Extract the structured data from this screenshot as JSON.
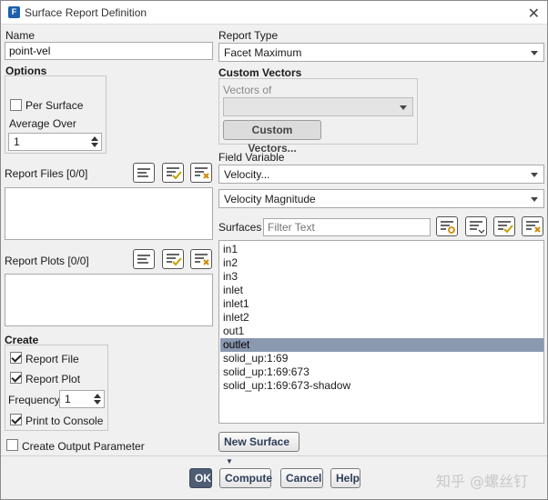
{
  "window": {
    "title": "Surface Report Definition",
    "icon": "fluent-app-icon",
    "close": "✕"
  },
  "name": {
    "label": "Name",
    "value": "point-vel"
  },
  "options": {
    "label": "Options",
    "per_surface_label": "Per Surface",
    "per_surface_checked": false,
    "average_over_label": "Average Over",
    "average_over_value": "1"
  },
  "report_files": {
    "label": "Report Files [0/0]"
  },
  "report_plots": {
    "label": "Report Plots [0/0]"
  },
  "create": {
    "label": "Create",
    "report_file_label": "Report File",
    "report_file_checked": true,
    "report_plot_label": "Report Plot",
    "report_plot_checked": true,
    "frequency_label": "Frequency",
    "frequency_value": "1",
    "print_console_label": "Print to Console",
    "print_console_checked": true
  },
  "create_output_param": {
    "label": "Create Output Parameter",
    "checked": false
  },
  "report_type": {
    "label": "Report Type",
    "value": "Facet Maximum"
  },
  "custom_vectors": {
    "label": "Custom Vectors",
    "vectors_of_label": "Vectors of",
    "vectors_of_value": "",
    "button": "Custom Vectors..."
  },
  "field_variable": {
    "label": "Field Variable",
    "category": "Velocity...",
    "quantity": "Velocity Magnitude"
  },
  "surfaces": {
    "label": "Surfaces",
    "filter_placeholder": "Filter Text",
    "items": [
      "in1",
      "in2",
      "in3",
      "inlet",
      "inlet1",
      "inlet2",
      "out1",
      "outlet",
      "solid_up:1:69",
      "solid_up:1:69:673",
      "solid_up:1:69:673-shadow"
    ],
    "selected": "outlet",
    "new_surface_button": "New Surface"
  },
  "footer": {
    "ok": "OK",
    "compute": "Compute",
    "cancel": "Cancel",
    "help": "Help"
  },
  "watermark": "知乎 @螺丝钉",
  "colors": {
    "selection": "#8a98b0",
    "ok_button": "#4e5c74",
    "button_text": "#2d3d5a"
  }
}
